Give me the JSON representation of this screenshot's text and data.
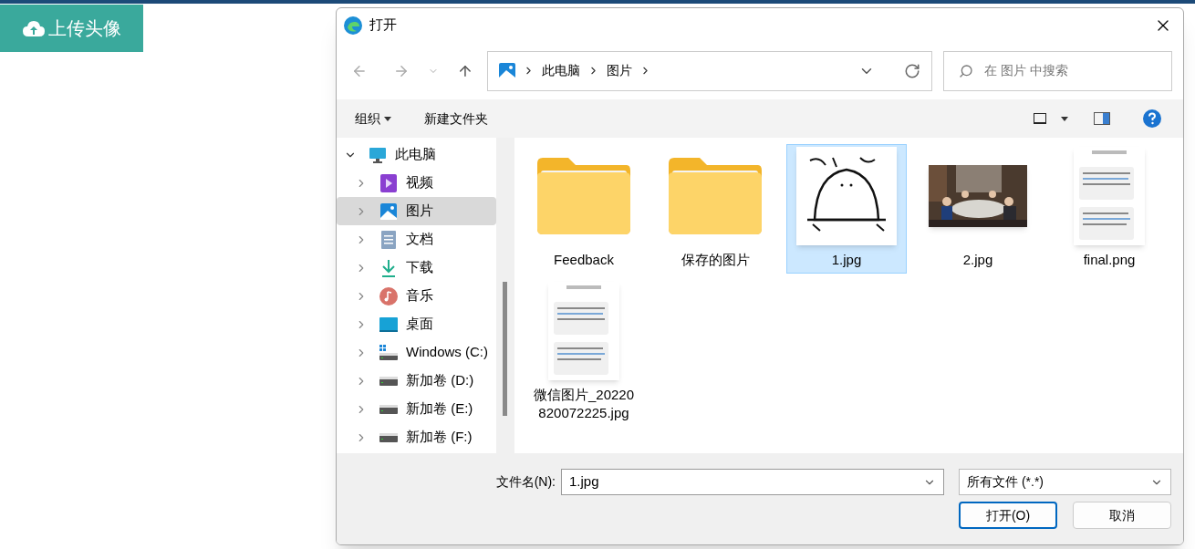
{
  "upload_button": {
    "label": "上传头像"
  },
  "dialog": {
    "title": "打开",
    "address": {
      "path": [
        "此电脑",
        "图片"
      ]
    },
    "search": {
      "placeholder": "在 图片 中搜索"
    },
    "toolbar": {
      "organize": "组织",
      "new_folder": "新建文件夹"
    },
    "tree": [
      {
        "label": "此电脑",
        "kind": "computer",
        "expanded": true,
        "selected": false,
        "children": [
          {
            "label": "视频",
            "kind": "video",
            "expanded": false,
            "selected": false
          },
          {
            "label": "图片",
            "kind": "pictures",
            "expanded": false,
            "selected": true
          },
          {
            "label": "文档",
            "kind": "documents",
            "expanded": false,
            "selected": false
          },
          {
            "label": "下载",
            "kind": "downloads",
            "expanded": false,
            "selected": false
          },
          {
            "label": "音乐",
            "kind": "music",
            "expanded": false,
            "selected": false
          },
          {
            "label": "桌面",
            "kind": "desktop",
            "expanded": false,
            "selected": false
          },
          {
            "label": "Windows (C:)",
            "kind": "system-drive",
            "expanded": false,
            "selected": false
          },
          {
            "label": "新加卷 (D:)",
            "kind": "drive",
            "expanded": false,
            "selected": false
          },
          {
            "label": "新加卷 (E:)",
            "kind": "drive",
            "expanded": false,
            "selected": false
          },
          {
            "label": "新加卷 (F:)",
            "kind": "drive",
            "expanded": false,
            "selected": false
          }
        ]
      }
    ],
    "files": [
      {
        "name": "Feedback",
        "kind": "folder",
        "selected": false
      },
      {
        "name": "保存的图片",
        "kind": "folder",
        "selected": false
      },
      {
        "name": "1.jpg",
        "kind": "sketch",
        "selected": true
      },
      {
        "name": "2.jpg",
        "selected": false
      },
      {
        "name": "final.png",
        "kind": "screenshot",
        "selected": false
      },
      {
        "name": "微信图片_20220820072225.jpg",
        "kind": "screenshot",
        "selected": false
      }
    ],
    "filename": {
      "label": "文件名(N):",
      "value": "1.jpg"
    },
    "filetype": {
      "value": "所有文件 (*.*)"
    },
    "buttons": [
      {
        "label": "打开(O)",
        "primary": true
      },
      {
        "label": "取消",
        "primary": false
      }
    ]
  }
}
